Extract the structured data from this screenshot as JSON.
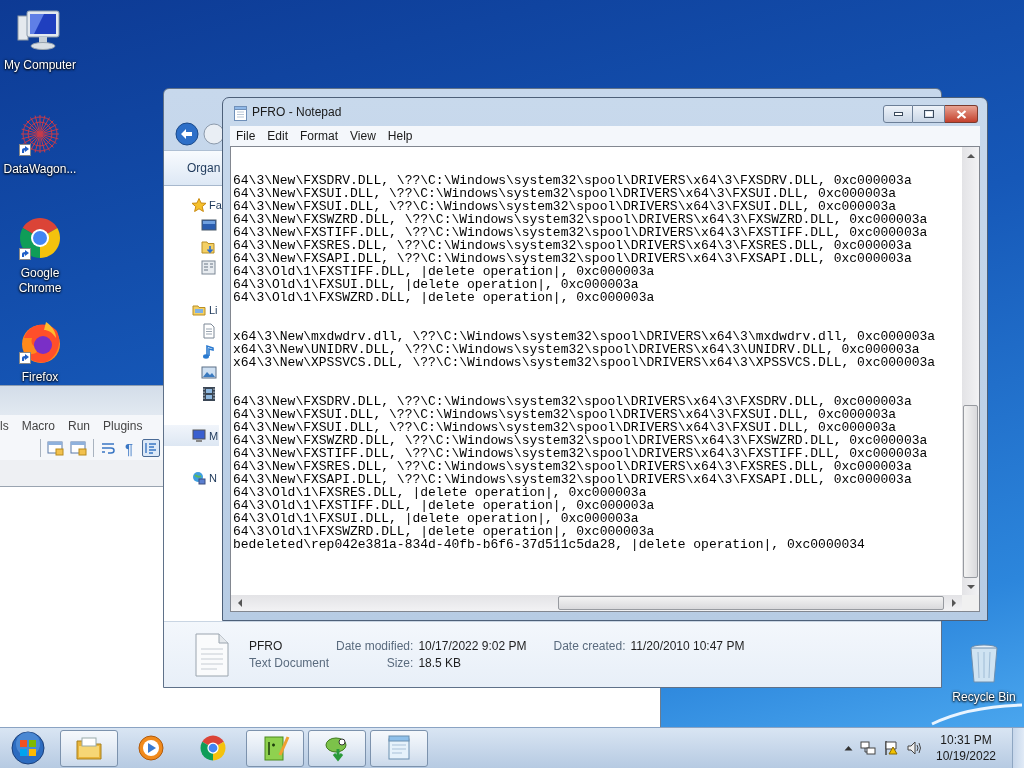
{
  "desktop_icons": [
    {
      "label": "My Computer",
      "kind": "computer",
      "shortcut": false
    },
    {
      "label": "DataWagon...",
      "kind": "datawagon",
      "shortcut": true
    },
    {
      "label": "Google Chrome",
      "kind": "chrome",
      "shortcut": true
    },
    {
      "label": "Firefox",
      "kind": "firefox",
      "shortcut": true
    },
    {
      "label": "Recycle Bin",
      "kind": "recycle",
      "shortcut": false
    }
  ],
  "notepad_plus_plus": {
    "menu": [
      "ls",
      "Macro",
      "Run",
      "Plugins"
    ],
    "toolbar_glyph": "¶"
  },
  "explorer": {
    "toolbar": "Organ",
    "nav": [
      {
        "label": "Fa",
        "kind": "favorites",
        "selected": false
      },
      {
        "label": "Li",
        "kind": "libraries",
        "selected": false
      },
      {
        "label": "M",
        "kind": "computer",
        "selected": true
      },
      {
        "label": "N",
        "kind": "network",
        "selected": false
      }
    ],
    "details": {
      "name": "PFRO",
      "type": "Text Document",
      "fields": [
        {
          "label": "Date modified:",
          "value": "10/17/2022 9:02 PM"
        },
        {
          "label": "Date created:",
          "value": "11/20/2010 10:47 PM"
        },
        {
          "label": "Size:",
          "value": "18.5 KB"
        }
      ]
    }
  },
  "notepad": {
    "title": "PFRO - Notepad",
    "menu": [
      "File",
      "Edit",
      "Format",
      "View",
      "Help"
    ],
    "blocks": [
      [
        "64\\3\\New\\FXSDRV.DLL, \\??\\C:\\Windows\\system32\\spool\\DRIVERS\\x64\\3\\FXSDRV.DLL, 0xc000003a",
        "64\\3\\New\\FXSUI.DLL, \\??\\C:\\Windows\\system32\\spool\\DRIVERS\\x64\\3\\FXSUI.DLL, 0xc000003a",
        "64\\3\\New\\FXSUI.DLL, \\??\\C:\\Windows\\system32\\spool\\DRIVERS\\x64\\3\\FXSUI.DLL, 0xc000003a",
        "64\\3\\New\\FXSWZRD.DLL, \\??\\C:\\Windows\\system32\\spool\\DRIVERS\\x64\\3\\FXSWZRD.DLL, 0xc000003a",
        "64\\3\\New\\FXSTIFF.DLL, \\??\\C:\\Windows\\system32\\spool\\DRIVERS\\x64\\3\\FXSTIFF.DLL, 0xc000003a",
        "64\\3\\New\\FXSRES.DLL, \\??\\C:\\Windows\\system32\\spool\\DRIVERS\\x64\\3\\FXSRES.DLL, 0xc000003a",
        "64\\3\\New\\FXSAPI.DLL, \\??\\C:\\Windows\\system32\\spool\\DRIVERS\\x64\\3\\FXSAPI.DLL, 0xc000003a",
        "64\\3\\Old\\1\\FXSTIFF.DLL, |delete operation|, 0xc000003a",
        "64\\3\\Old\\1\\FXSUI.DLL, |delete operation|, 0xc000003a",
        "64\\3\\Old\\1\\FXSWZRD.DLL, |delete operation|, 0xc000003a"
      ],
      [
        "x64\\3\\New\\mxdwdrv.dll, \\??\\C:\\Windows\\system32\\spool\\DRIVERS\\x64\\3\\mxdwdrv.dll, 0xc000003a",
        "x64\\3\\New\\UNIDRV.DLL, \\??\\C:\\Windows\\system32\\spool\\DRIVERS\\x64\\3\\UNIDRV.DLL, 0xc000003a",
        "x64\\3\\New\\XPSSVCS.DLL, \\??\\C:\\Windows\\system32\\spool\\DRIVERS\\x64\\3\\XPSSVCS.DLL, 0xc000003a"
      ],
      [
        "64\\3\\New\\FXSDRV.DLL, \\??\\C:\\Windows\\system32\\spool\\DRIVERS\\x64\\3\\FXSDRV.DLL, 0xc000003a",
        "64\\3\\New\\FXSUI.DLL, \\??\\C:\\Windows\\system32\\spool\\DRIVERS\\x64\\3\\FXSUI.DLL, 0xc000003a",
        "64\\3\\New\\FXSUI.DLL, \\??\\C:\\Windows\\system32\\spool\\DRIVERS\\x64\\3\\FXSUI.DLL, 0xc000003a",
        "64\\3\\New\\FXSWZRD.DLL, \\??\\C:\\Windows\\system32\\spool\\DRIVERS\\x64\\3\\FXSWZRD.DLL, 0xc000003a",
        "64\\3\\New\\FXSTIFF.DLL, \\??\\C:\\Windows\\system32\\spool\\DRIVERS\\x64\\3\\FXSTIFF.DLL, 0xc000003a",
        "64\\3\\New\\FXSRES.DLL, \\??\\C:\\Windows\\system32\\spool\\DRIVERS\\x64\\3\\FXSRES.DLL, 0xc000003a",
        "64\\3\\New\\FXSAPI.DLL, \\??\\C:\\Windows\\system32\\spool\\DRIVERS\\x64\\3\\FXSAPI.DLL, 0xc000003a",
        "64\\3\\Old\\1\\FXSRES.DLL, |delete operation|, 0xc000003a",
        "64\\3\\Old\\1\\FXSTIFF.DLL, |delete operation|, 0xc000003a",
        "64\\3\\Old\\1\\FXSUI.DLL, |delete operation|, 0xc000003a",
        "64\\3\\Old\\1\\FXSWZRD.DLL, |delete operation|, 0xc000003a",
        "bedeleted\\rep042e381a-834d-40fb-b6f6-37d511c5da28, |delete operation|, 0xc0000034"
      ]
    ]
  },
  "taskbar": {
    "apps": [
      {
        "kind": "explorer",
        "running": true
      },
      {
        "kind": "media",
        "running": false
      },
      {
        "kind": "chrome",
        "running": false
      },
      {
        "kind": "notepadpp",
        "running": true
      },
      {
        "kind": "chameleon",
        "running": true
      },
      {
        "kind": "notepad",
        "running": true
      }
    ],
    "clock": {
      "time": "10:31 PM",
      "date": "10/19/2022"
    }
  }
}
